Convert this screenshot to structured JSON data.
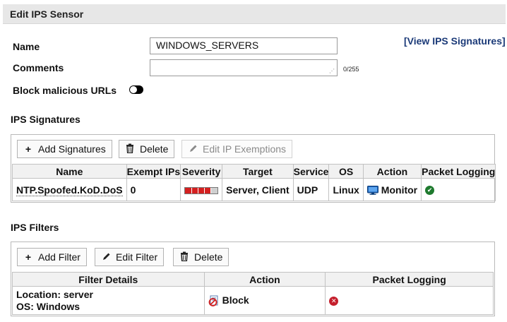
{
  "header": {
    "title": "Edit IPS Sensor"
  },
  "form": {
    "name_label": "Name",
    "name_value": "WINDOWS_SERVERS",
    "comments_label": "Comments",
    "comments_value": "",
    "comments_counter": "0/255",
    "block_urls_label": "Block malicious URLs",
    "block_urls_enabled": false,
    "view_signatures_link": "[View IPS Signatures]"
  },
  "signatures": {
    "section_title": "IPS Signatures",
    "toolbar": {
      "add_label": "Add Signatures",
      "delete_label": "Delete",
      "edit_exemptions_label": "Edit IP Exemptions"
    },
    "columns": [
      "Name",
      "Exempt IPs",
      "Severity",
      "Target",
      "Service",
      "OS",
      "Action",
      "Packet Logging"
    ],
    "rows": [
      {
        "name": "NTP.Spoofed.KoD.DoS",
        "exempt_ips": "0",
        "severity_level": 0.8,
        "target": "Server, Client",
        "service": "UDP",
        "os": "Linux",
        "action": "Monitor",
        "action_icon": "monitor-icon",
        "packet_logging": true,
        "packet_logging_icon": "check-circle-icon"
      }
    ]
  },
  "filters": {
    "section_title": "IPS Filters",
    "toolbar": {
      "add_label": "Add Filter",
      "edit_label": "Edit Filter",
      "delete_label": "Delete"
    },
    "columns": [
      "Filter Details",
      "Action",
      "Packet Logging"
    ],
    "rows": [
      {
        "details_line1": "Location: server",
        "details_line2": "OS: Windows",
        "action": "Block",
        "action_icon": "block-icon",
        "packet_logging": false,
        "packet_logging_icon": "x-circle-icon"
      }
    ]
  },
  "colors": {
    "header_bg": "#e7e7e7",
    "link": "#1b3a78",
    "severity_red": "#d42020",
    "ok_green": "#1e7a2e",
    "error_red": "#c51f2c"
  }
}
